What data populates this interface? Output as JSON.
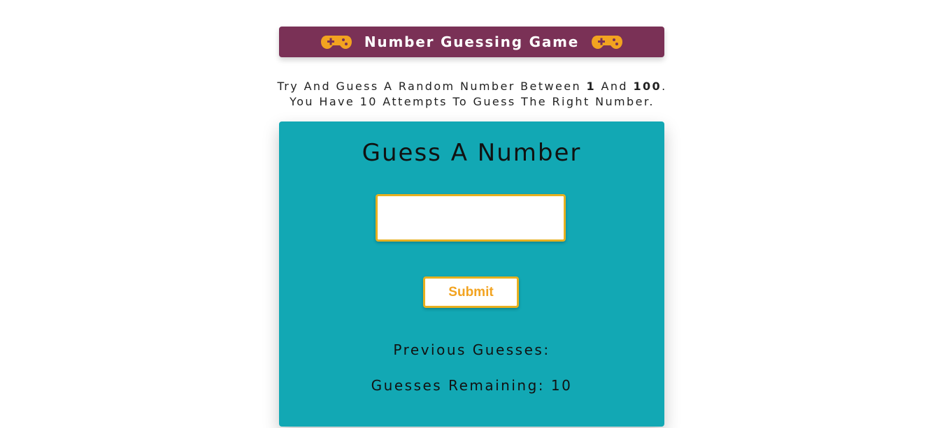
{
  "header": {
    "title": "Number Guessing Game",
    "icon": "gamepad-icon",
    "colors": {
      "background": "#7a3156",
      "icon": "#f2a320",
      "text": "#ffffff"
    }
  },
  "intro": {
    "line1_prefix": "Try And Guess A Random Number Between ",
    "min": "1",
    "line1_middle": " And ",
    "max": "100",
    "line1_suffix": ".",
    "line2": "You Have 10 Attempts To Guess The Right Number."
  },
  "game": {
    "heading": "Guess A Number",
    "input_value": "",
    "submit_label": "Submit",
    "previous_guesses_label": "Previous Guesses:",
    "remaining_label": "Guesses Remaining: 10",
    "colors": {
      "card": "#12a8b4",
      "accent": "#e7b01f",
      "button_text": "#f2a320"
    }
  }
}
